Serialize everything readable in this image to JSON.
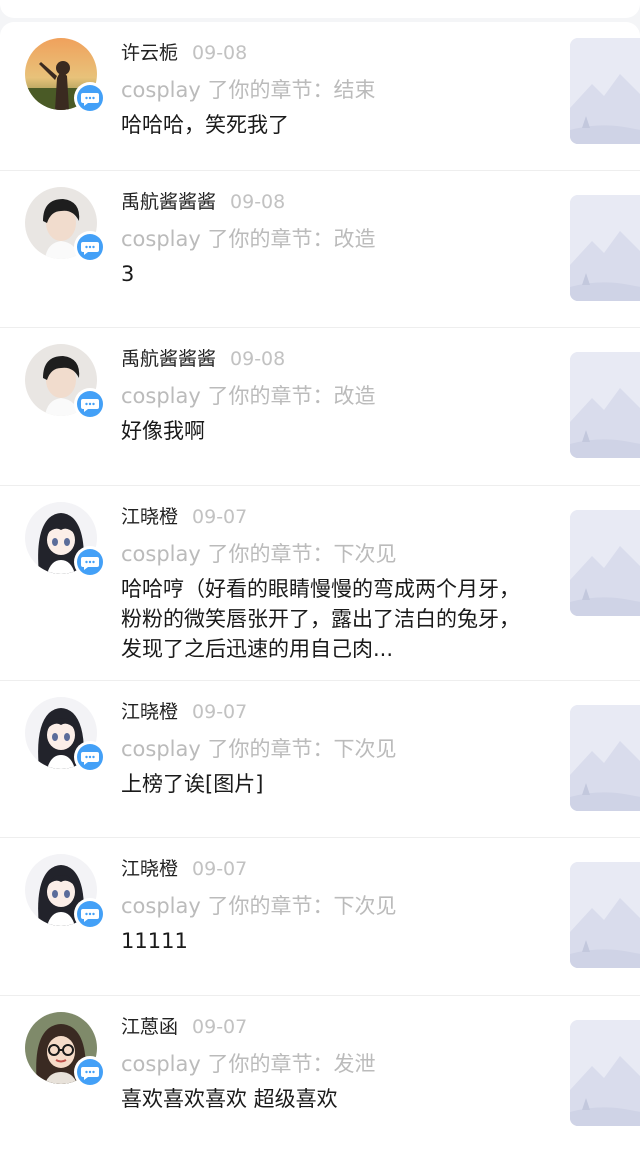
{
  "notifications": [
    {
      "username": "许云栀",
      "date": "09-08",
      "chapter_prefix": "cosplay 了你的章节：",
      "chapter": "结束",
      "comment": "哈哈哈，笑死我了",
      "avatar": "sunset-girl-avatar"
    },
    {
      "username": "禹航酱酱酱",
      "date": "09-08",
      "chapter_prefix": "cosplay 了你的章节：",
      "chapter": "改造",
      "comment": "3",
      "avatar": "boy-avatar"
    },
    {
      "username": "禹航酱酱酱",
      "date": "09-08",
      "chapter_prefix": "cosplay 了你的章节：",
      "chapter": "改造",
      "comment": "好像我啊",
      "avatar": "boy-avatar"
    },
    {
      "username": "江晓橙",
      "date": "09-07",
      "chapter_prefix": "cosplay 了你的章节：",
      "chapter": "下次见",
      "comment": "哈哈哼（好看的眼睛慢慢的弯成两个月牙，粉粉的微笑唇张开了，露出了洁白的兔牙，发现了之后迅速的用自己肉...",
      "avatar": "anime-girl-avatar"
    },
    {
      "username": "江晓橙",
      "date": "09-07",
      "chapter_prefix": "cosplay 了你的章节：",
      "chapter": "下次见",
      "comment": "上榜了诶[图片]",
      "avatar": "anime-girl-avatar"
    },
    {
      "username": "江晓橙",
      "date": "09-07",
      "chapter_prefix": "cosplay 了你的章节：",
      "chapter": "下次见",
      "comment": "11111",
      "avatar": "anime-girl-avatar"
    },
    {
      "username": "江蒽函",
      "date": "09-07",
      "chapter_prefix": "cosplay 了你的章节：",
      "chapter": "发泄",
      "comment": "喜欢喜欢喜欢 超级喜欢",
      "avatar": "glasses-girl-avatar"
    }
  ],
  "icons": {
    "badge": "chat-bubble-icon",
    "thumbnail": "image-placeholder-icon"
  },
  "colors": {
    "badge": "#43a0f7",
    "username": "#222222",
    "muted": "#bbbbbb",
    "thumbnail_bg": "#e8eaf4"
  }
}
